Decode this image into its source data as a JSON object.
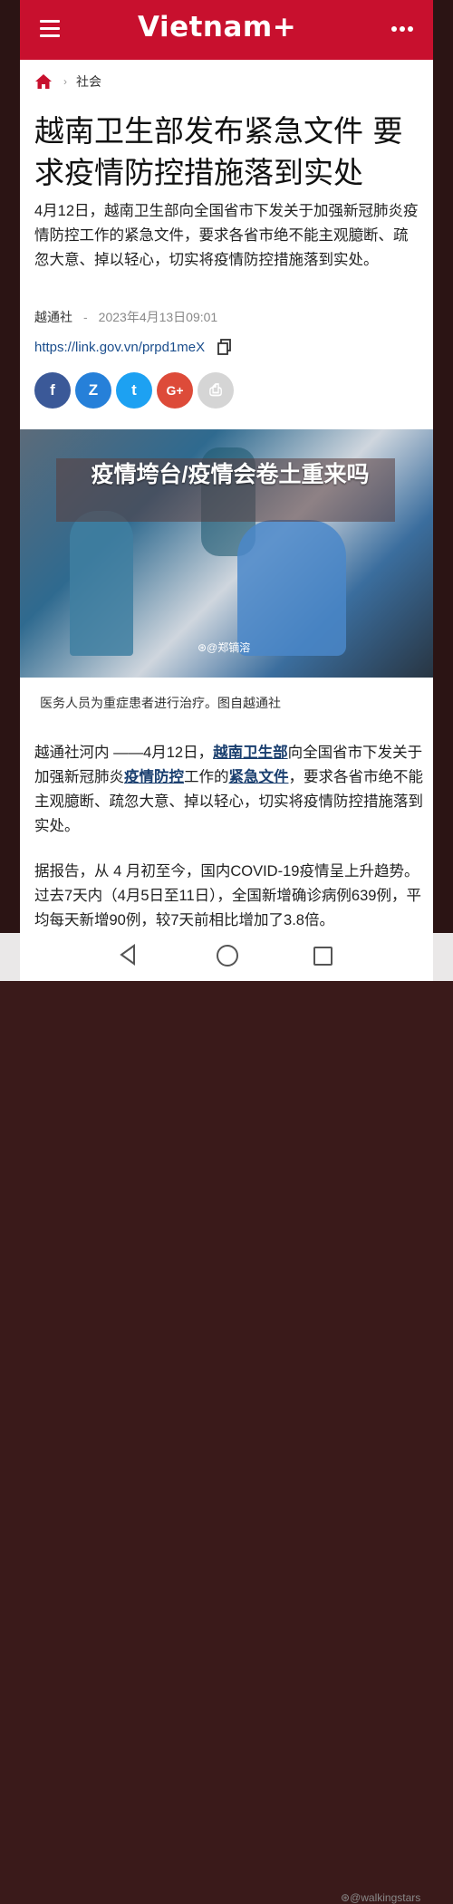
{
  "header": {
    "logo": "Vietnam+",
    "menu_icon": "hamburger-menu-icon",
    "more_icon": "more-dots-icon",
    "brand_color": "#c8102e"
  },
  "breadcrumb": {
    "home_icon": "home-icon",
    "section": "社会"
  },
  "article": {
    "title": "越南卫生部发布紧急文件 要求疫情防控措施落到实处",
    "lead": "4月12日，越南卫生部向全国省市下发关于加强新冠肺炎疫情防控工作的紧急文件，要求各省市绝不能主观臆断、疏忽大意、掉以轻心，切实将疫情防控措施落到实处。",
    "source": "越通社",
    "date": "2023年4月13日09:01",
    "short_link": "https://link.gov.vn/prpd1meX",
    "share_buttons": [
      {
        "label": "f",
        "icon": "facebook-icon",
        "color": "#3b5998"
      },
      {
        "label": "Z",
        "icon": "zalo-icon",
        "color": "#2680d9"
      },
      {
        "label": "t",
        "icon": "twitter-icon",
        "color": "#1da1f2"
      },
      {
        "label": "G+",
        "icon": "google-plus-icon",
        "color": "#dd4b39"
      },
      {
        "label": "⎙",
        "icon": "print-icon",
        "color": "#d5d5d5"
      }
    ],
    "image_overlay": "疫情垮台/疫情会卷土重来吗",
    "image_watermark": "⊛@郑镝溶",
    "caption": "医务人员为重症患者进行治疗。图自越通社",
    "body1_prefix": "越通社河内 ——4月12日，",
    "body1_link1": "越南卫生部",
    "body1_mid1": "向全国省市下发关于加强新冠肺炎",
    "body1_link2": "疫情防控",
    "body1_mid2": "工作的",
    "body1_link3": "紧急文件",
    "body1_suffix": "，要求各省市绝不能主观臆断、疏忽大意、掉以轻心，切实将疫情防控措施落到实处。",
    "body2": "据报告，从 4 月初至今，国内COVID-19疫情呈上升趋势。过去7天内（4月5日至11日），全国新增确诊病例639例，平均每天新增90例，较7天前相比增加了3.8倍。"
  },
  "system_nav": {
    "back_icon": "back-triangle-icon",
    "home_icon": "home-circle-icon",
    "recent_icon": "recent-apps-icon",
    "watermark": "⊛@walkingstars"
  }
}
